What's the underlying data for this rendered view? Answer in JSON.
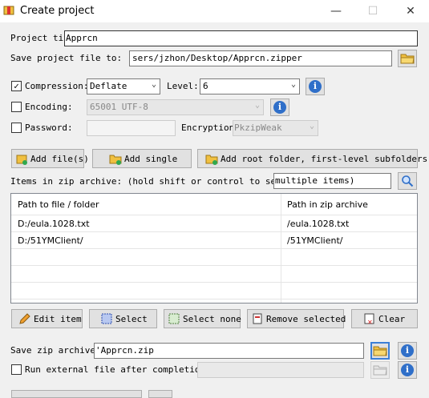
{
  "window": {
    "title": "Create project",
    "minimize": "—",
    "maximize": "☐",
    "close": "✕"
  },
  "project_title": {
    "label": "Project tit",
    "value": "Apprcn"
  },
  "save_project": {
    "label": "Save project file to:",
    "value": "sers/jzhon/Desktop/Apprcn.zipper"
  },
  "compression": {
    "label": "Compression:",
    "checked": true,
    "method": "Deflate",
    "level_label": "Level:",
    "level": "6"
  },
  "encoding": {
    "label": "Encoding:",
    "checked": false,
    "value": "65001 UTF-8"
  },
  "password": {
    "label": "Password:",
    "checked": false,
    "value": "",
    "encryption_label": "Encryption:",
    "encryption": "PkzipWeak"
  },
  "add_buttons": {
    "add_files": "Add file(s)",
    "add_single": "Add single",
    "add_root": "Add root folder, first-level subfolders"
  },
  "items": {
    "label": "Items in zip archive: (hold shift or control to select",
    "label_tail": "multiple items)",
    "columns": [
      "Path to file / folder",
      "Path in zip archive"
    ],
    "rows": [
      [
        "D:/eula.1028.txt",
        "/eula.1028.txt"
      ],
      [
        "D:/51YMClient/",
        "/51YMClient/"
      ]
    ]
  },
  "item_buttons": {
    "edit": "Edit item",
    "select": "Select",
    "select_none": "Select none",
    "remove": "Remove selected",
    "clear": "Clear"
  },
  "save_zip": {
    "label": "Save zip archive to:",
    "value": "'Apprcn.zip"
  },
  "run_external": {
    "label": "Run external file after completion:",
    "checked": false,
    "value": ""
  },
  "colors": {
    "info_blue": "#2f6fc9",
    "folder_yellow": "#f0c040",
    "focus_blue": "#3c7fd6"
  }
}
